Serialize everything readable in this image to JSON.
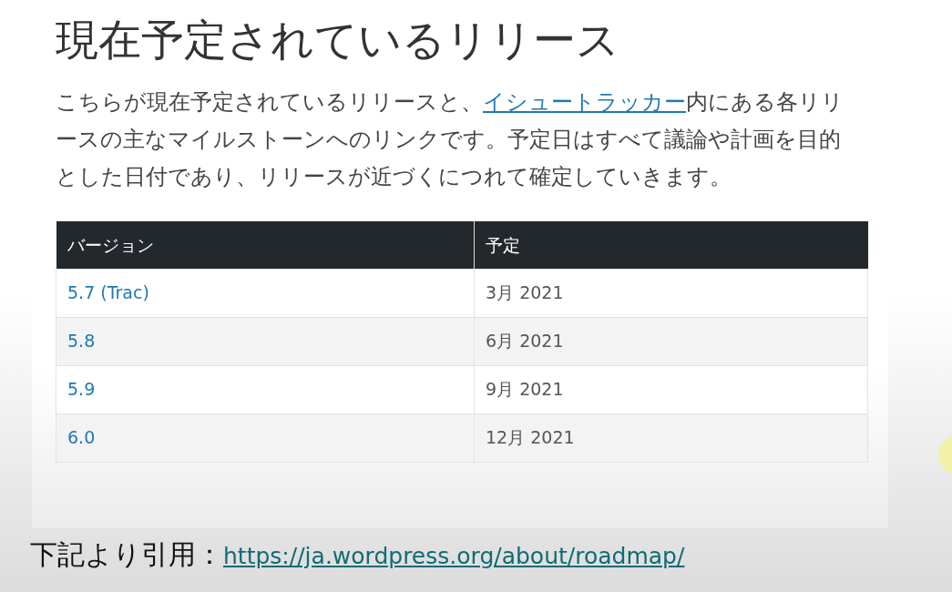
{
  "heading": "現在予定されているリリース",
  "intro": {
    "before": "こちらが現在予定されているリリースと、",
    "link": "イシュートラッカー",
    "after": "内にある各リリースの主なマイルストーンへのリンクです。予定日はすべて議論や計画を目的とした日付であり、リリースが近づくにつれて確定していきます。"
  },
  "table": {
    "columns": [
      "バージョン",
      "予定"
    ],
    "rows": [
      {
        "version": "5.7",
        "link": "(Trac)",
        "date": "3月 2021"
      },
      {
        "version": "5.8",
        "date": "6月 2021"
      },
      {
        "version": "5.9",
        "date": "9月 2021"
      },
      {
        "version": "6.0",
        "date": "12月 2021"
      }
    ]
  },
  "caption": {
    "label": "下記より引用：",
    "url": "https://ja.wordpress.org/about/roadmap/"
  }
}
